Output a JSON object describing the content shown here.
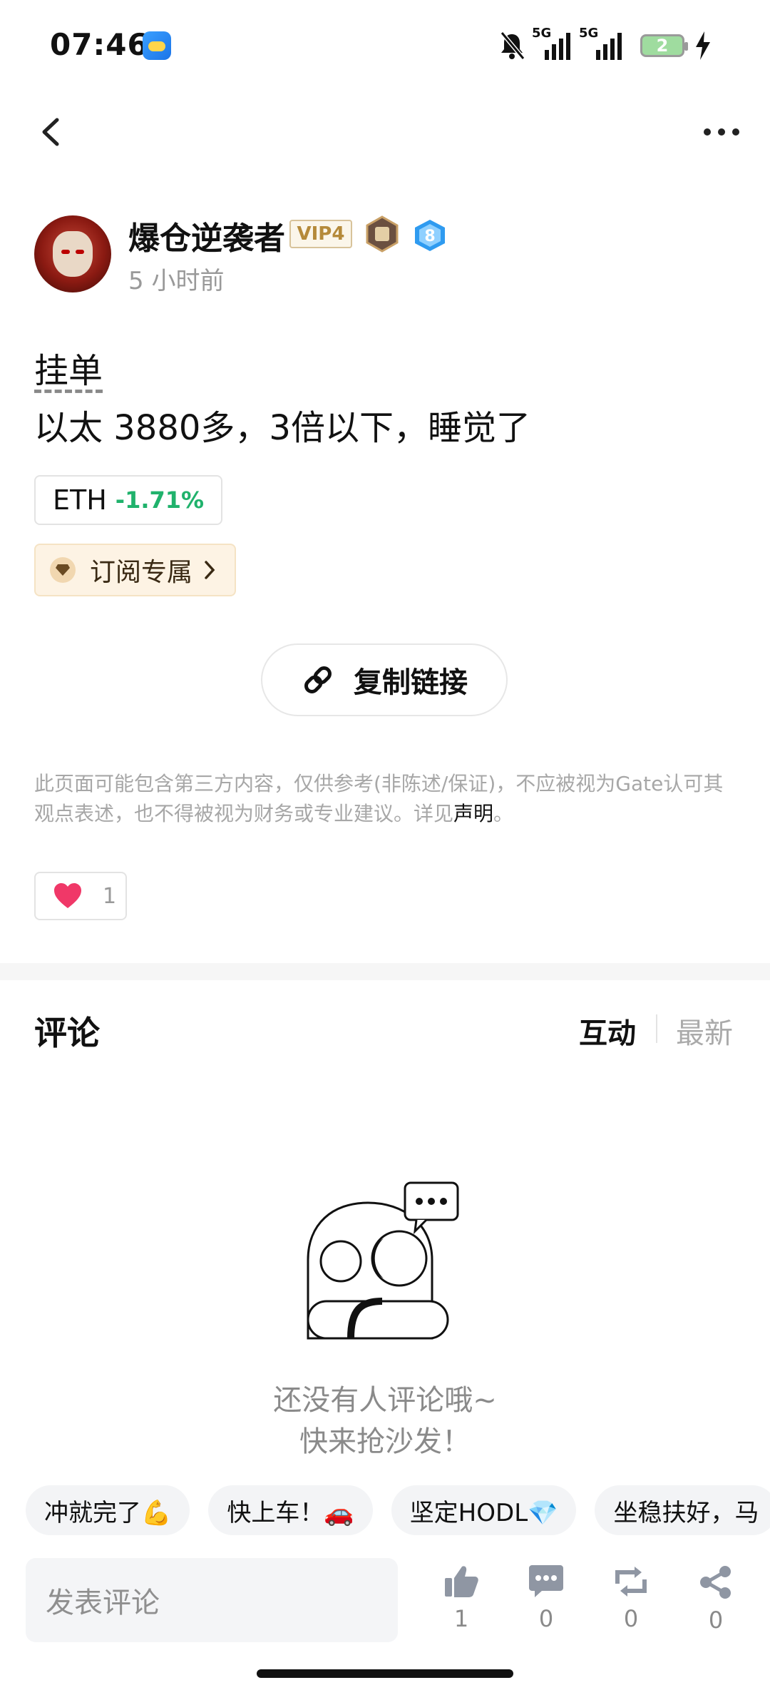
{
  "status_bar": {
    "time": "07:46",
    "battery": "2",
    "network_1": "5G",
    "network_2": "5G"
  },
  "author": {
    "name": "爆仓逆袭者",
    "vip": "VIP4",
    "level": "8",
    "time_ago": "5 小时前"
  },
  "post": {
    "title": "挂单",
    "body": "以太 3880多，3倍以下，睡觉了",
    "ticker": {
      "symbol": "ETH",
      "change": "-1.71%"
    },
    "subscribe_label": "订阅专属",
    "copy_link_label": "复制链接",
    "disclaimer_text": "此页面可能包含第三方内容，仅供参考(非陈述/保证)，不应被视为Gate认可其观点表述，也不得被视为财务或专业建议。详见",
    "disclaimer_link": "声明",
    "disclaimer_end": "。",
    "like_count": "1"
  },
  "comments": {
    "title": "评论",
    "sort_active": "互动",
    "sort_other": "最新",
    "empty_line1": "还没有人评论哦~",
    "empty_line2": "快来抢沙发！"
  },
  "quick_replies": [
    "冲就完了💪",
    "快上车！🚗",
    "坚定HODL💎",
    "坐稳扶好，马"
  ],
  "bottom_bar": {
    "input_placeholder": "发表评论",
    "like_count": "1",
    "comment_count": "0",
    "repost_count": "0",
    "share_count": "0"
  },
  "colors": {
    "positive": "#20b26c",
    "vip_gold": "#b58a3a",
    "level_blue": "#2f9bf0"
  }
}
